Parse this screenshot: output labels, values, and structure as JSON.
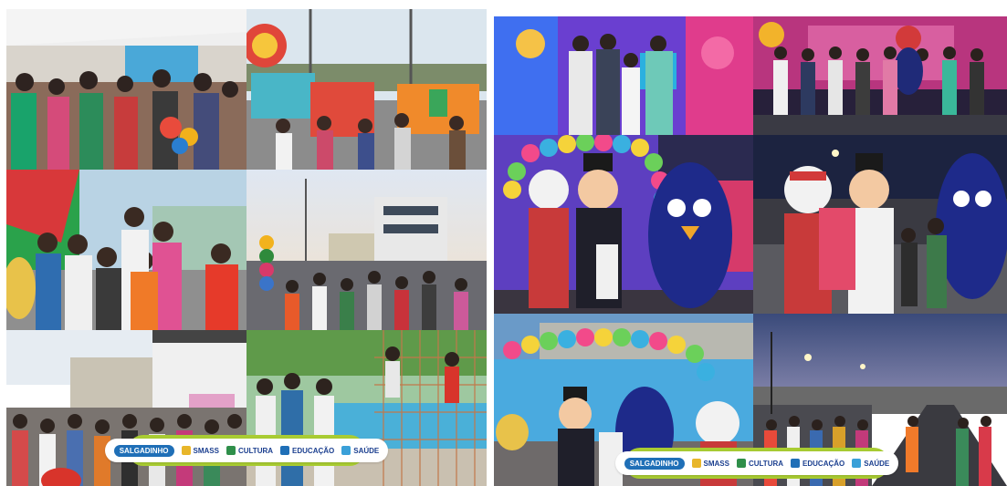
{
  "collages": [
    {
      "id": "left",
      "photos": [
        {
          "scene": "crowd-under-tent-with-balloons"
        },
        {
          "scene": "crowd-street-inflatables-sign"
        },
        {
          "scene": "children-group-portrait"
        },
        {
          "scene": "street-festival-crowd-dusk"
        },
        {
          "scene": "street-crowd-daytime"
        },
        {
          "scene": "children-playground-net"
        }
      ],
      "footer": {
        "logos": [
          {
            "icon": "salgadinho-logo",
            "label": "SALGADINHO",
            "color": "#1f6fb7"
          },
          {
            "icon": "smass-logo",
            "label": "SMASS",
            "color": "#1b3f8f"
          },
          {
            "icon": "cultura-logo",
            "label": "CULTURA",
            "color": "#1b3f8f"
          },
          {
            "icon": "educacao-logo",
            "label": "EDUCAÇÃO",
            "color": "#1b3f8f"
          },
          {
            "icon": "saude-logo",
            "label": "SAÚDE",
            "color": "#1b3f8f"
          }
        ]
      }
    },
    {
      "id": "right",
      "photos": [
        {
          "scene": "stage-group-portrait-backdrop"
        },
        {
          "scene": "stage-group-portrait-night"
        },
        {
          "scene": "mascots-balloon-arch"
        },
        {
          "scene": "mascots-street-night"
        },
        {
          "scene": "mascots-balloon-arch-street"
        },
        {
          "scene": "street-crowd-night-lights"
        }
      ],
      "footer": {
        "logos": [
          {
            "icon": "salgadinho-logo",
            "label": "SALGADINHO",
            "color": "#1f6fb7"
          },
          {
            "icon": "smass-logo",
            "label": "SMASS",
            "color": "#1b3f8f"
          },
          {
            "icon": "cultura-logo",
            "label": "CULTURA",
            "color": "#1b3f8f"
          },
          {
            "icon": "educacao-logo",
            "label": "EDUCAÇÃO",
            "color": "#1b3f8f"
          },
          {
            "icon": "saude-logo",
            "label": "SAÚDE",
            "color": "#1b3f8f"
          }
        ]
      }
    }
  ],
  "colors": {
    "footer_bar": "#a9cc32",
    "stage_purple": "#6a3fd0",
    "stage_pink": "#e03c8c",
    "night_sky": "#1c2340"
  }
}
